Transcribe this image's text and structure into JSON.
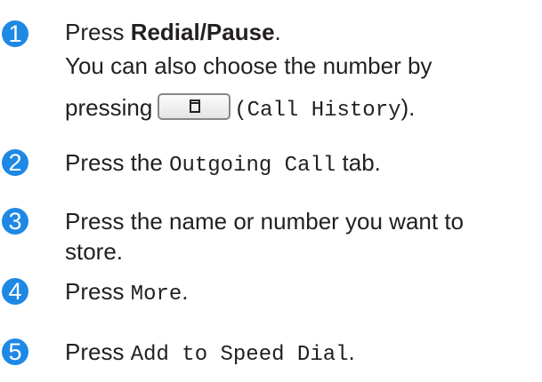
{
  "colors": {
    "step_badge": "#1e88e5"
  },
  "steps": [
    {
      "number": "1",
      "text_before": "Press ",
      "bold": "Redial/Pause",
      "text_after": ".",
      "line2": "You can also choose the number by",
      "line3_before": "pressing",
      "button_icon": "copy-icon",
      "mono": "(Call History",
      "line3_after": ")."
    },
    {
      "number": "2",
      "before": "Press the ",
      "mono": "Outgoing Call",
      "after": " tab."
    },
    {
      "number": "3",
      "line1": "Press the name or number you want to",
      "line2": "store."
    },
    {
      "number": "4",
      "before": "Press ",
      "mono": "More",
      "after": "."
    },
    {
      "number": "5",
      "before": "Press ",
      "mono": "Add to Speed Dial",
      "after": "."
    }
  ]
}
